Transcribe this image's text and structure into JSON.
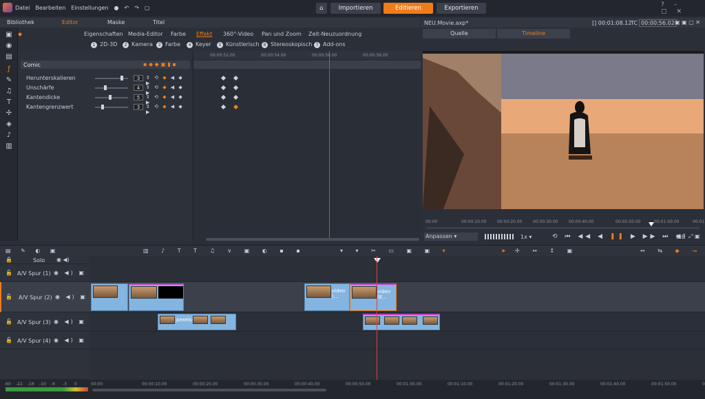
{
  "menu": [
    "Datei",
    "Bearbeiten",
    "Einstellungen"
  ],
  "top_tabs": {
    "home": "⌂",
    "import": "Importieren",
    "edit": "Editieren",
    "export": "Exportieren"
  },
  "panel_tabs": {
    "library": "Bibliothek",
    "editor": "Editor",
    "mask": "Maske",
    "title": "Titel"
  },
  "sub_tabs": [
    "Eigenschaften",
    "Media-Editor",
    "Farbe",
    "Effekt",
    "360°-Video",
    "Pan und Zoom",
    "Zeit-Neuzuordnung"
  ],
  "effect_options": [
    {
      "n": "1",
      "label": "2D-3D"
    },
    {
      "n": "2",
      "label": "Kamera"
    },
    {
      "n": "3",
      "label": "Farbe"
    },
    {
      "n": "4",
      "label": "Keyer"
    },
    {
      "n": "5",
      "label": "Künstlerisch"
    },
    {
      "n": "6",
      "label": "Stereoskopisch"
    },
    {
      "n": "7",
      "label": "Add-ons"
    }
  ],
  "effect_name": "Comic",
  "params": [
    {
      "label": "Herunterskalieren",
      "value": "3",
      "level": 0.85
    },
    {
      "label": "Unschärfe",
      "value": "4",
      "level": 0.3
    },
    {
      "label": "Kantendicke",
      "value": "5",
      "level": 0.45
    },
    {
      "label": "Kantengrenzwert",
      "value": "3",
      "level": 0.2
    }
  ],
  "kf_ruler": [
    "00:00:00",
    "00:00:52.00",
    "00:00:54.00",
    "00:00:56.00",
    "00:00:58.00"
  ],
  "preview": {
    "file": "NEU.Movie.axp*",
    "time1": "[] 00:01:08.12",
    "tc_label": "TC",
    "tc": "00:00:56.02",
    "source": "Quelle",
    "timeline": "Timeline"
  },
  "preview_ruler": [
    "00:00",
    "00:00:10.00",
    "00:00:20.00",
    "00:00:30.00",
    "00:00:40.00",
    "00:00:50.00",
    "00:01:00.00",
    "00:01"
  ],
  "controls": {
    "fit": "Anpassen",
    "speed": "1x",
    "bib": "BiB"
  },
  "tracks": [
    {
      "name": "Solo"
    },
    {
      "name": "A/V Spur (1)"
    },
    {
      "name": "A/V Spur (2)"
    },
    {
      "name": "A/V Spur (3)"
    },
    {
      "name": "A/V Spur (4)"
    }
  ],
  "clip_names": {
    "c1": "video (...",
    "c2": "video (E...",
    "c3": "pexels-..."
  },
  "timeline_ticks": [
    "00:00",
    "00:00:10.00",
    "00:00:20.00",
    "00:00:30.00",
    "00:00:40.00",
    "00:00:50.00",
    "00:01:00.00",
    "00:01:10.00",
    "00:01:20.00",
    "00:01:30.00",
    "00:01:40.00",
    "00:01:50.00",
    "00:02:00"
  ],
  "meter_labels": [
    "-60",
    "-22",
    "-16",
    "-10",
    "-6",
    "-3",
    "0"
  ],
  "colors": {
    "accent": "#f07d1a",
    "playhead": "#e04040",
    "clip": "#84b4e0"
  }
}
